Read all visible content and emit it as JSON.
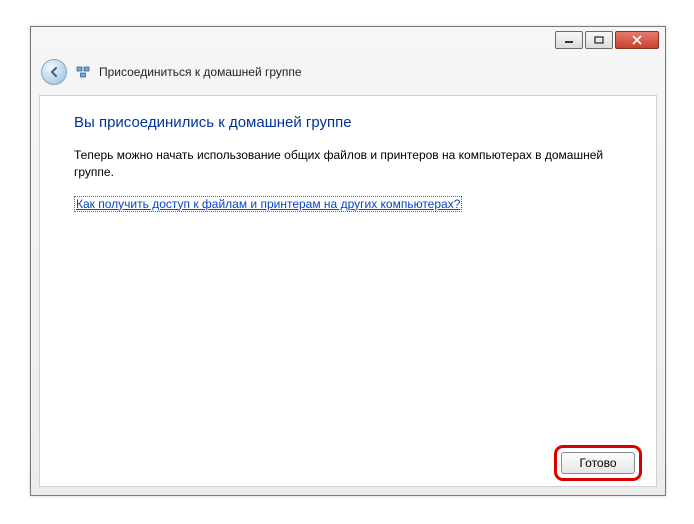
{
  "window": {
    "wizard_title": "Присоединиться к домашней группе"
  },
  "content": {
    "heading": "Вы присоединились к домашней группе",
    "body": "Теперь можно начать использование общих файлов и принтеров на компьютерах в домашней группе.",
    "help_link": "Как получить доступ к файлам и принтерам на других компьютерах?"
  },
  "buttons": {
    "done": "Готово"
  }
}
